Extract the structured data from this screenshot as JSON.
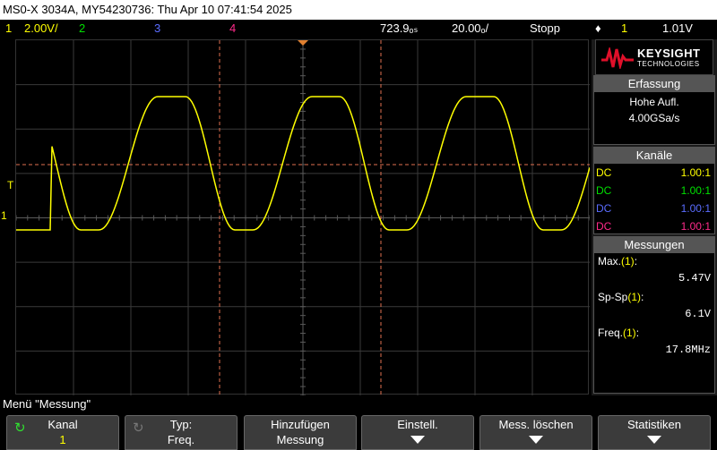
{
  "titlebar": {
    "text": "MS0-X 3034A, MY54230736: Thu Apr 10 07:41:54 2025"
  },
  "topbar": {
    "ch1": "1",
    "ch1_scale": "2.00V/",
    "ch2": "2",
    "ch3": "3",
    "ch4": "4",
    "delay": "723.9ₒₛ",
    "timebase": "20.00ₒ/",
    "run_state": "Stopp",
    "trigger_icon": "♦",
    "trig_source": "1",
    "trig_level": "1.01V"
  },
  "colors": {
    "ch1": "#ffff00",
    "ch2": "#00e000",
    "ch3": "#5a6cff",
    "ch4": "#ff2a8a",
    "cursor": "#e07050"
  },
  "screen_marks": {
    "trigger_marker": "T",
    "ch1_ground": "1"
  },
  "logo": {
    "brand": "KEYSIGHT",
    "sub": "TECHNOLOGIES"
  },
  "acquisition": {
    "header": "Erfassung",
    "mode": "Hohe Aufl.",
    "rate": "4.00GSa/s"
  },
  "channels": {
    "header": "Kanäle",
    "rows": [
      {
        "coupling": "DC",
        "probe": "1.00:1",
        "color": "#ffff00"
      },
      {
        "coupling": "DC",
        "probe": "1.00:1",
        "color": "#00e000"
      },
      {
        "coupling": "DC",
        "probe": "1.00:1",
        "color": "#5a6cff"
      },
      {
        "coupling": "DC",
        "probe": "1.00:1",
        "color": "#ff2a8a"
      }
    ]
  },
  "measurements": {
    "header": "Messungen",
    "items": [
      {
        "label": "Max.",
        "chan": "(1)",
        "suffix": ":",
        "value": "5.47V"
      },
      {
        "label": "Sp-Sp",
        "chan": "(1)",
        "suffix": ":",
        "value": "6.1V"
      },
      {
        "label": "Freq.",
        "chan": "(1)",
        "suffix": ":",
        "value": "17.8MHz"
      }
    ]
  },
  "menu": {
    "title": "Menü \"Messung\""
  },
  "softkeys": [
    {
      "line1": "Kanal",
      "line2": "1",
      "icon": "↻"
    },
    {
      "line1": "Typ:",
      "line2": "Freq.",
      "icon": "↻"
    },
    {
      "line1": "Hinzufügen",
      "line2": "Messung"
    },
    {
      "line1": "Einstell.",
      "line2": ""
    },
    {
      "line1": "Mess. löschen",
      "line2": ""
    },
    {
      "line1": "Statistiken",
      "line2": ""
    }
  ]
}
